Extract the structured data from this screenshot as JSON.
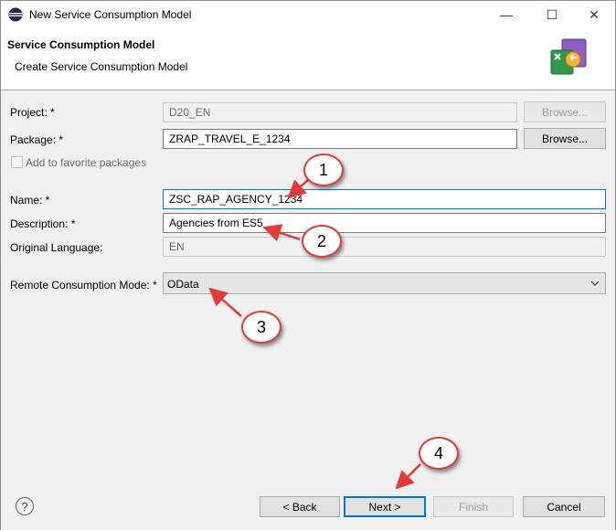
{
  "window": {
    "title": "New Service Consumption Model",
    "minimize_glyph": "—",
    "maximize_glyph": "☐",
    "close_glyph": "✕"
  },
  "banner": {
    "title": "Service Consumption Model",
    "subtitle": "Create Service Consumption Model",
    "icon": "wizard-banner-icon"
  },
  "form": {
    "project": {
      "label": "Project: *",
      "value": "D20_EN",
      "button": "Browse..."
    },
    "package": {
      "label": "Package: *",
      "value": "ZRAP_TRAVEL_E_1234",
      "button": "Browse..."
    },
    "favorite": {
      "label": "Add to favorite packages",
      "checked": false
    },
    "name": {
      "label": "Name: *",
      "value": "ZSC_RAP_AGENCY_1234"
    },
    "description": {
      "label": "Description: *",
      "value": "Agencies from ES5"
    },
    "language": {
      "label": "Original Language:",
      "value": "EN"
    },
    "mode": {
      "label": "Remote Consumption Mode: *",
      "value": "OData"
    }
  },
  "footer": {
    "help_glyph": "?",
    "back": "< Back",
    "next": "Next >",
    "finish": "Finish",
    "cancel": "Cancel"
  },
  "callouts": [
    "1",
    "2",
    "3",
    "4"
  ],
  "colors": {
    "accent": "#0078d7",
    "callout_border": "#e53935",
    "arrow": "#e53935",
    "dialog_bg": "#f0f0f0"
  }
}
